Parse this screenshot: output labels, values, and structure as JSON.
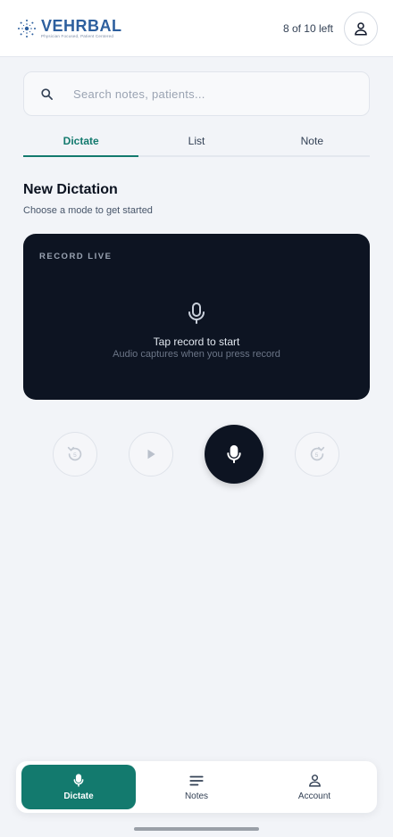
{
  "header": {
    "logo_word": "VEHRBAL",
    "logo_tagline": "Physician Focused, Patient Centered",
    "quota": "8 of 10 left",
    "avatar_icon": "person-icon"
  },
  "search": {
    "placeholder": "Search notes, patients..."
  },
  "tabs": [
    {
      "label": "Dictate",
      "active": true
    },
    {
      "label": "List",
      "active": false
    },
    {
      "label": "Note",
      "active": false
    }
  ],
  "main": {
    "title": "New Dictation",
    "subtitle": "Choose a mode to get started"
  },
  "record_card": {
    "label": "RECORD LIVE",
    "title": "Tap record to start",
    "hint": "Audio captures when you press record",
    "icon": "microphone-icon"
  },
  "controls": {
    "rewind_icon": "rewind-icon",
    "play_icon": "play-icon",
    "record_icon": "microphone-icon",
    "forward_icon": "forward-icon"
  },
  "bottom_nav": [
    {
      "label": "Dictate",
      "icon": "microphone-icon",
      "active": true
    },
    {
      "label": "Notes",
      "icon": "notes-icon",
      "active": false
    },
    {
      "label": "Account",
      "icon": "person-icon",
      "active": false
    }
  ],
  "colors": {
    "accent": "#137a6e",
    "dark_card": "#0d1422",
    "background": "#f2f4f8",
    "logo_blue": "#2d5f9e"
  }
}
